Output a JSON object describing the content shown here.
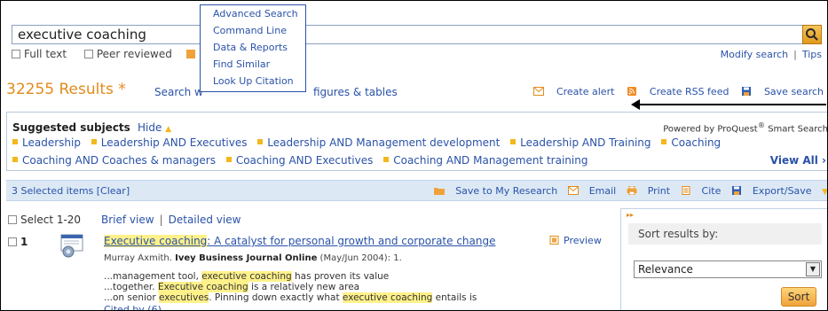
{
  "search": {
    "query": "executive coaching",
    "full_text_label": "Full text",
    "peer_reviewed_label": "Peer reviewed",
    "modify_search": "Modify search",
    "tips": "Tips"
  },
  "dropdown_menu": {
    "items": [
      "Advanced Search",
      "Command Line",
      "Data & Reports",
      "Find Similar",
      "Look Up Citation"
    ]
  },
  "results_bar": {
    "count": "32255 Results *",
    "search_within_head": "Search w",
    "search_within_tail": "figures & tables",
    "create_alert": "Create alert",
    "create_rss": "Create RSS feed",
    "save_search": "Save search"
  },
  "suggested": {
    "title": "Suggested subjects",
    "hide": "Hide",
    "powered_by": "Powered by ProQuest",
    "powered_reg": "®",
    "powered_tail": " Smart Search",
    "row1": [
      "Leadership",
      "Leadership AND Executives",
      "Leadership AND Management development",
      "Leadership AND Training",
      "Coaching"
    ],
    "row2": [
      "Coaching AND Coaches & managers",
      "Coaching AND Executives",
      "Coaching AND Management training"
    ],
    "view_all": "View All"
  },
  "selection_bar": {
    "selected": "3 Selected items [Clear]",
    "save_to_my_research": "Save to My Research",
    "email": "Email",
    "print": "Print",
    "cite": "Cite",
    "export_save": "Export/Save"
  },
  "results": {
    "select_range": "Select 1-20",
    "brief_view": "Brief view",
    "detailed_view": "Detailed view",
    "items": [
      {
        "number": "1",
        "title_highlight": "Executive coaching",
        "title_rest": ": A catalyst for personal growth and corporate change",
        "author": "Murray Axmith. ",
        "source": "Ivey Business Journal Online",
        "date": " (May/Jun 2004): 1.",
        "snippet1_pre": "...management tool, ",
        "snippet1_hl": "executive coaching",
        "snippet1_post": " has proven its value",
        "snippet2_pre": "...together. ",
        "snippet2_hl": "Executive coaching",
        "snippet2_post": " is a relatively new area",
        "snippet3_pre": "...on senior ",
        "snippet3_hl": "executives",
        "snippet3_mid": ". Pinning down exactly what ",
        "snippet3_hl2": "executive coaching",
        "snippet3_post": " entails is",
        "cited_by": "Cited by (6)",
        "preview": "Preview"
      }
    ]
  },
  "sort_panel": {
    "chevron": "▸▸",
    "heading": "Sort results by:",
    "selected_option": "Relevance",
    "sort_button": "Sort"
  },
  "colors": {
    "accent_orange": "#e28b1c",
    "link_blue": "#2a52a8",
    "highlight_yellow": "#fff18a",
    "bar_blue": "#dce9f5"
  }
}
